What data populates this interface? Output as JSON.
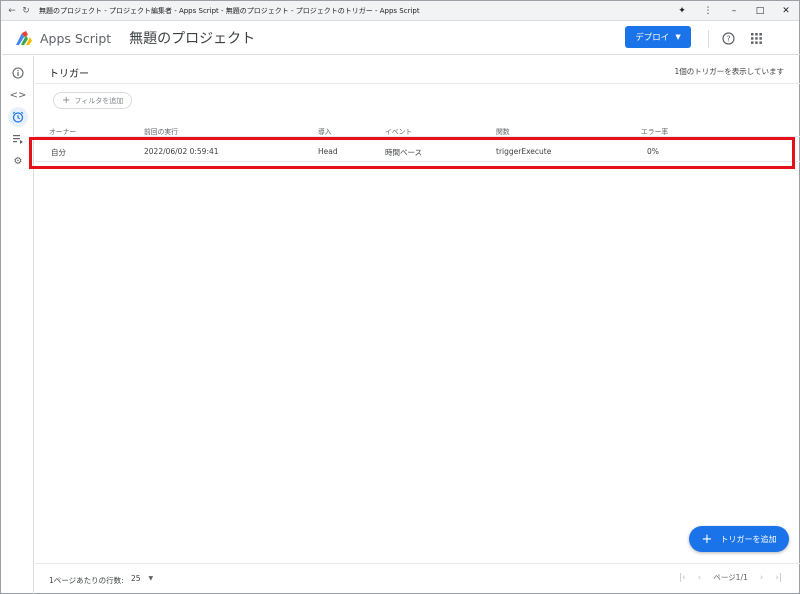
{
  "window": {
    "title": "無題のプロジェクト - プロジェクト編集者 - Apps Script - 無題のプロジェクト - プロジェクトのトリガー - Apps Script"
  },
  "header": {
    "brand": "Apps Script",
    "project_name": "無題のプロジェクト",
    "deploy_label": "デプロイ"
  },
  "rail": {
    "items": [
      {
        "name": "overview",
        "icon": "info-icon"
      },
      {
        "name": "editor",
        "icon": "code-icon"
      },
      {
        "name": "triggers",
        "icon": "alarm-clock-icon",
        "active": true
      },
      {
        "name": "executions",
        "icon": "list-run-icon"
      },
      {
        "name": "settings",
        "icon": "gear-icon"
      }
    ]
  },
  "page": {
    "title": "トリガー",
    "info": "1個のトリガーを表示しています",
    "filter_label": "フィルタを追加"
  },
  "table": {
    "headers": [
      "オーナー",
      "前回の実行",
      "導入",
      "イベント",
      "関数",
      "エラー率"
    ],
    "rows": [
      [
        "自分",
        "2022/06/02 0:59:41",
        "Head",
        "時間ベース",
        "triggerExecute",
        "0%"
      ]
    ]
  },
  "fab": {
    "label": "トリガーを追加"
  },
  "footer": {
    "rows_per_page_label": "1ページあたりの行数:",
    "rows_per_page_value": "25",
    "page_label": "ページ1/1"
  },
  "colors": {
    "accent": "#1a73e8",
    "highlight": "#e5101a"
  }
}
